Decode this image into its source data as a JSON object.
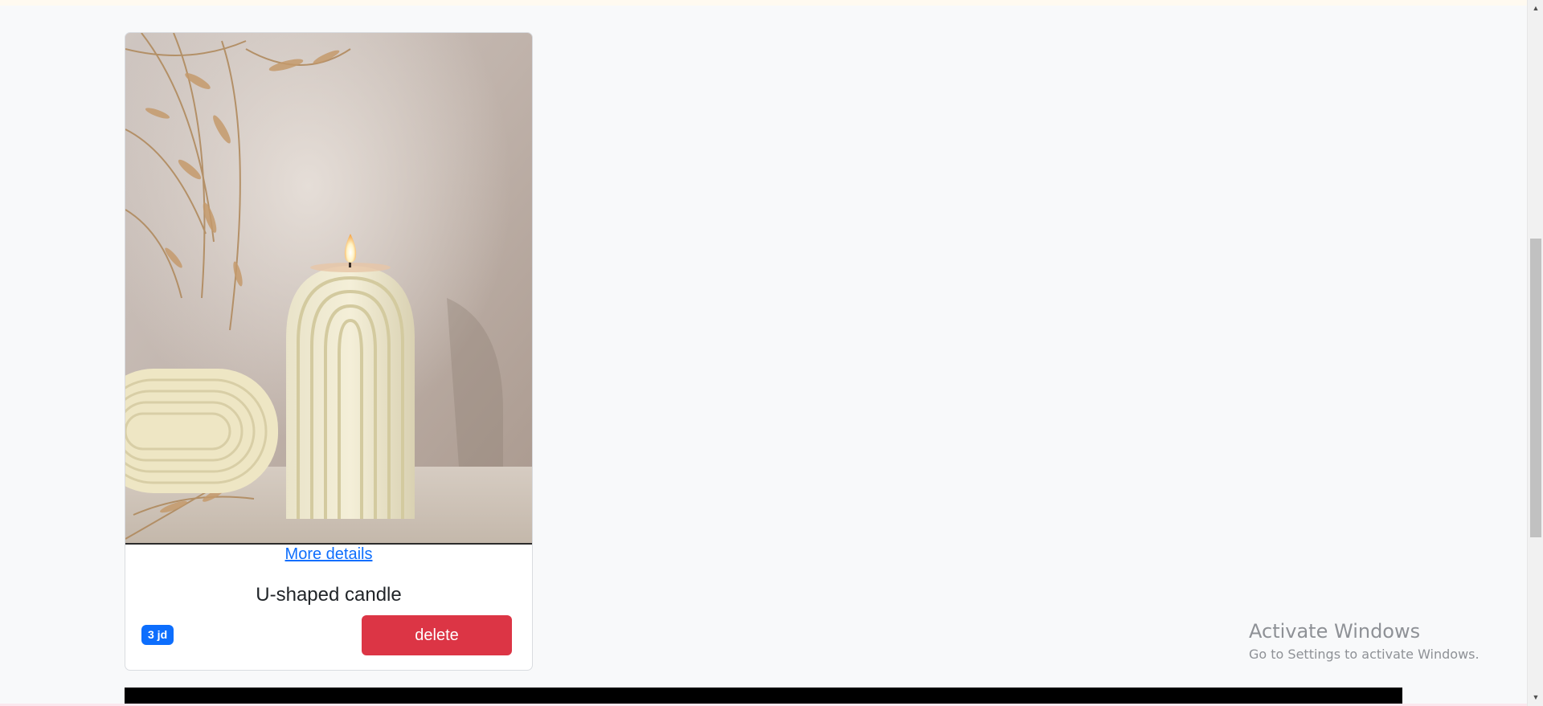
{
  "product": {
    "details_link": "More details",
    "name": "U-shaped candle",
    "price": "3 jd",
    "delete_label": "delete",
    "image_alt": "U-shaped candle"
  },
  "watermark": {
    "title": "Activate Windows",
    "subtitle": "Go to Settings to activate Windows."
  },
  "scrollbar": {
    "up_icon": "▲",
    "down_icon": "▼"
  },
  "colors": {
    "page_bg": "#f8f9fa",
    "primary": "#0d6efd",
    "danger": "#dc3545",
    "footer": "#000000"
  }
}
